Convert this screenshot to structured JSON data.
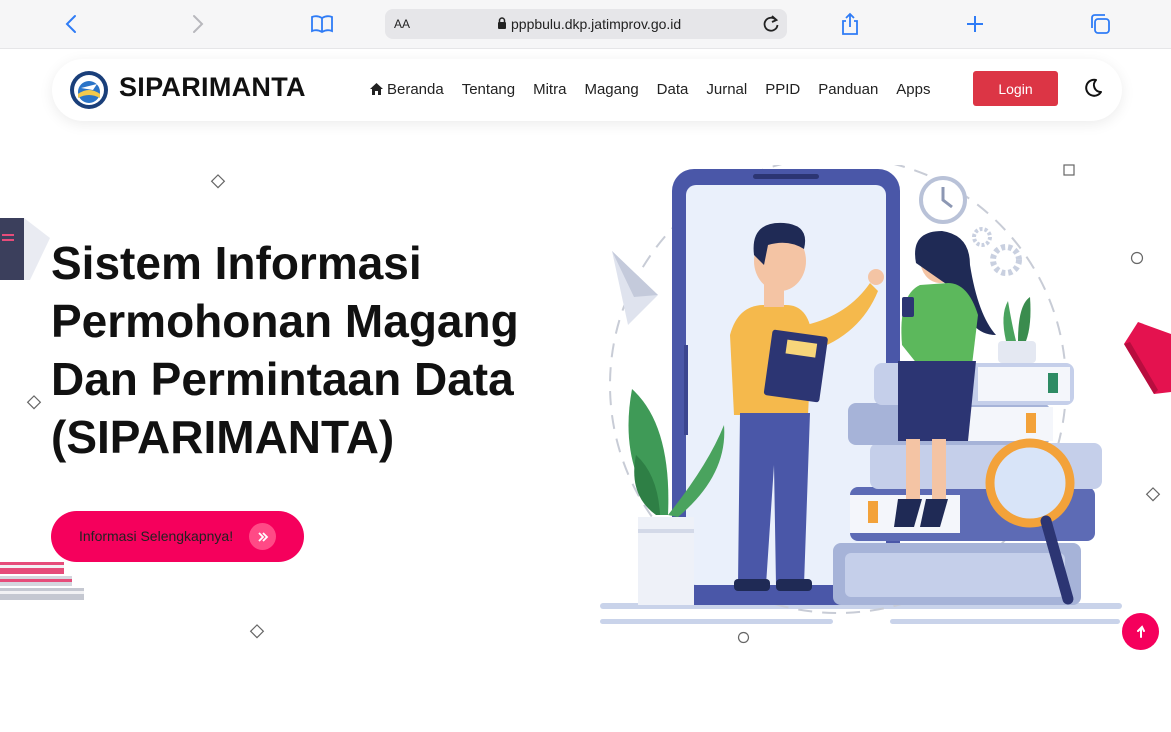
{
  "browser": {
    "text_size_label": "AA",
    "url": "pppbulu.dkp.jatimprov.go.id"
  },
  "navbar": {
    "brand": "SIPARIMANTA",
    "links": [
      "Beranda",
      "Tentang",
      "Mitra",
      "Magang",
      "Data",
      "Jurnal",
      "PPID",
      "Panduan",
      "Apps"
    ],
    "login_label": "Login"
  },
  "hero": {
    "title_line1": "Sistem Informasi",
    "title_line2": "Permohonan Magang",
    "title_line3": "Dan Permintaan Data",
    "title_line4": "(SIPARIMANTA)",
    "cta_label": "Informasi Selengkapnya!"
  },
  "colors": {
    "accent": "#f5005c",
    "login": "#dc3545"
  }
}
